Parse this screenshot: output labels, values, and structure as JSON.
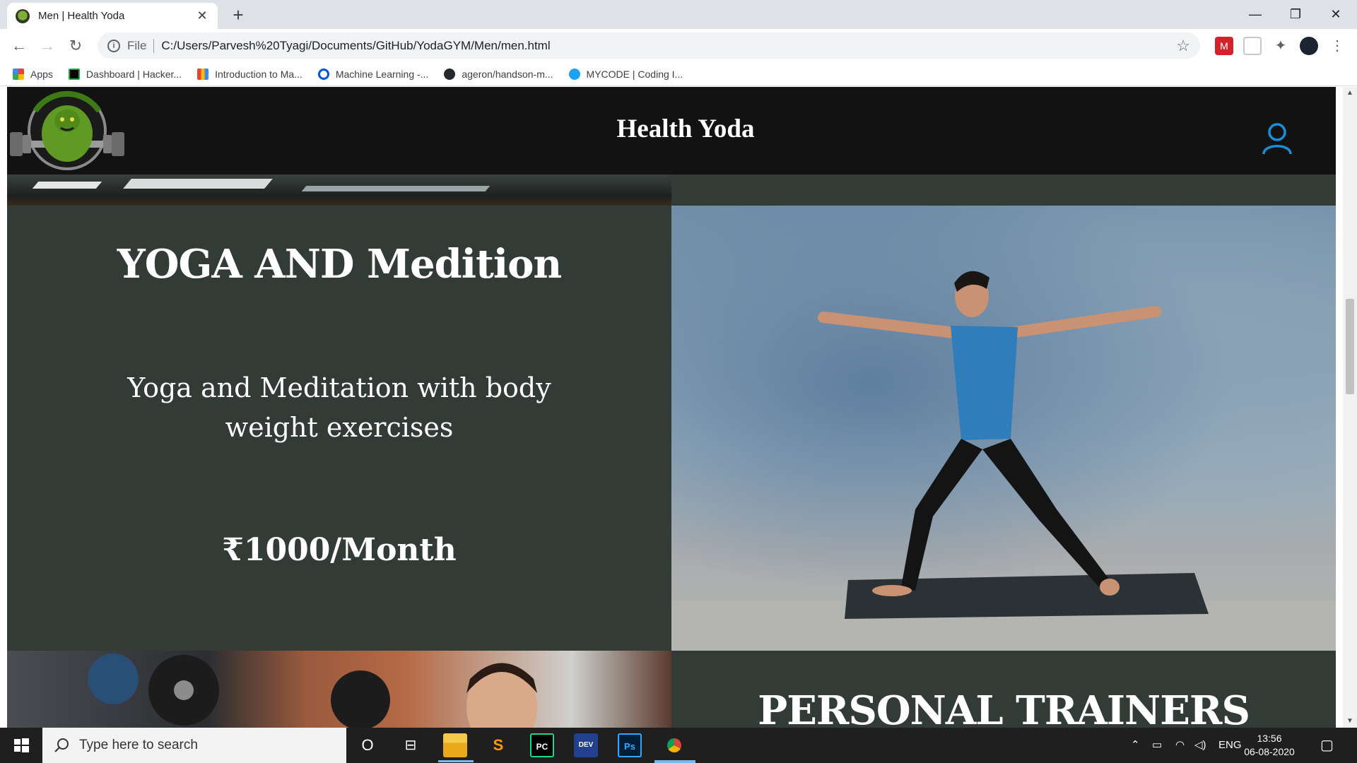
{
  "browser": {
    "tab_title": "Men | Health Yoda",
    "tab_close": "✕",
    "new_tab": "+",
    "window": {
      "minimize": "—",
      "restore": "❐",
      "close": "✕"
    },
    "nav": {
      "back": "←",
      "forward": "→",
      "reload": "↻"
    },
    "omnibox": {
      "scheme_label": "File",
      "url": "C:/Users/Parvesh%20Tyagi/Documents/GitHub/YodaGYM/Men/men.html",
      "star": "☆"
    },
    "bookmarks": [
      {
        "label": "Apps",
        "icon": "apps-grid-icon",
        "color": "#ea4335"
      },
      {
        "label": "Dashboard | Hacker...",
        "icon": "hackerrank-icon",
        "color": "#1ba94c"
      },
      {
        "label": "Introduction to Ma...",
        "icon": "code-brackets-icon",
        "color": "#4285f4"
      },
      {
        "label": "Machine Learning -...",
        "icon": "coursera-icon",
        "color": "#0056d2"
      },
      {
        "label": "ageron/handson-m...",
        "icon": "github-icon",
        "color": "#24292e"
      },
      {
        "label": "MYCODE | Coding I...",
        "icon": "mycode-icon",
        "color": "#1da1f2"
      }
    ]
  },
  "site": {
    "brand": "Health Yoda",
    "plan": {
      "title": "YOGA AND Medition",
      "description": "Yoga and Meditation with body weight exercises",
      "price": "₹1000/Month"
    },
    "next_section_title": "PERSONAL TRAINERS"
  },
  "taskbar": {
    "search_placeholder": "Type here to search",
    "language": "ENG",
    "time": "13:56",
    "date": "06-08-2020",
    "pinned": [
      {
        "name": "cortana-icon",
        "label": "O"
      },
      {
        "name": "task-view-icon",
        "label": "⊟"
      },
      {
        "name": "file-explorer-icon",
        "label": ""
      },
      {
        "name": "sublime-text-icon",
        "label": "S"
      },
      {
        "name": "pycharm-icon",
        "label": "PC"
      },
      {
        "name": "dev-cpp-icon",
        "label": "DEV"
      },
      {
        "name": "photoshop-icon",
        "label": "Ps"
      },
      {
        "name": "chrome-icon",
        "label": ""
      }
    ]
  },
  "colors": {
    "header_bg": "#121212",
    "panel_bg": "#333b37",
    "user_icon": "#1a8ed6",
    "taskbar_bg": "#1f1f1f"
  }
}
